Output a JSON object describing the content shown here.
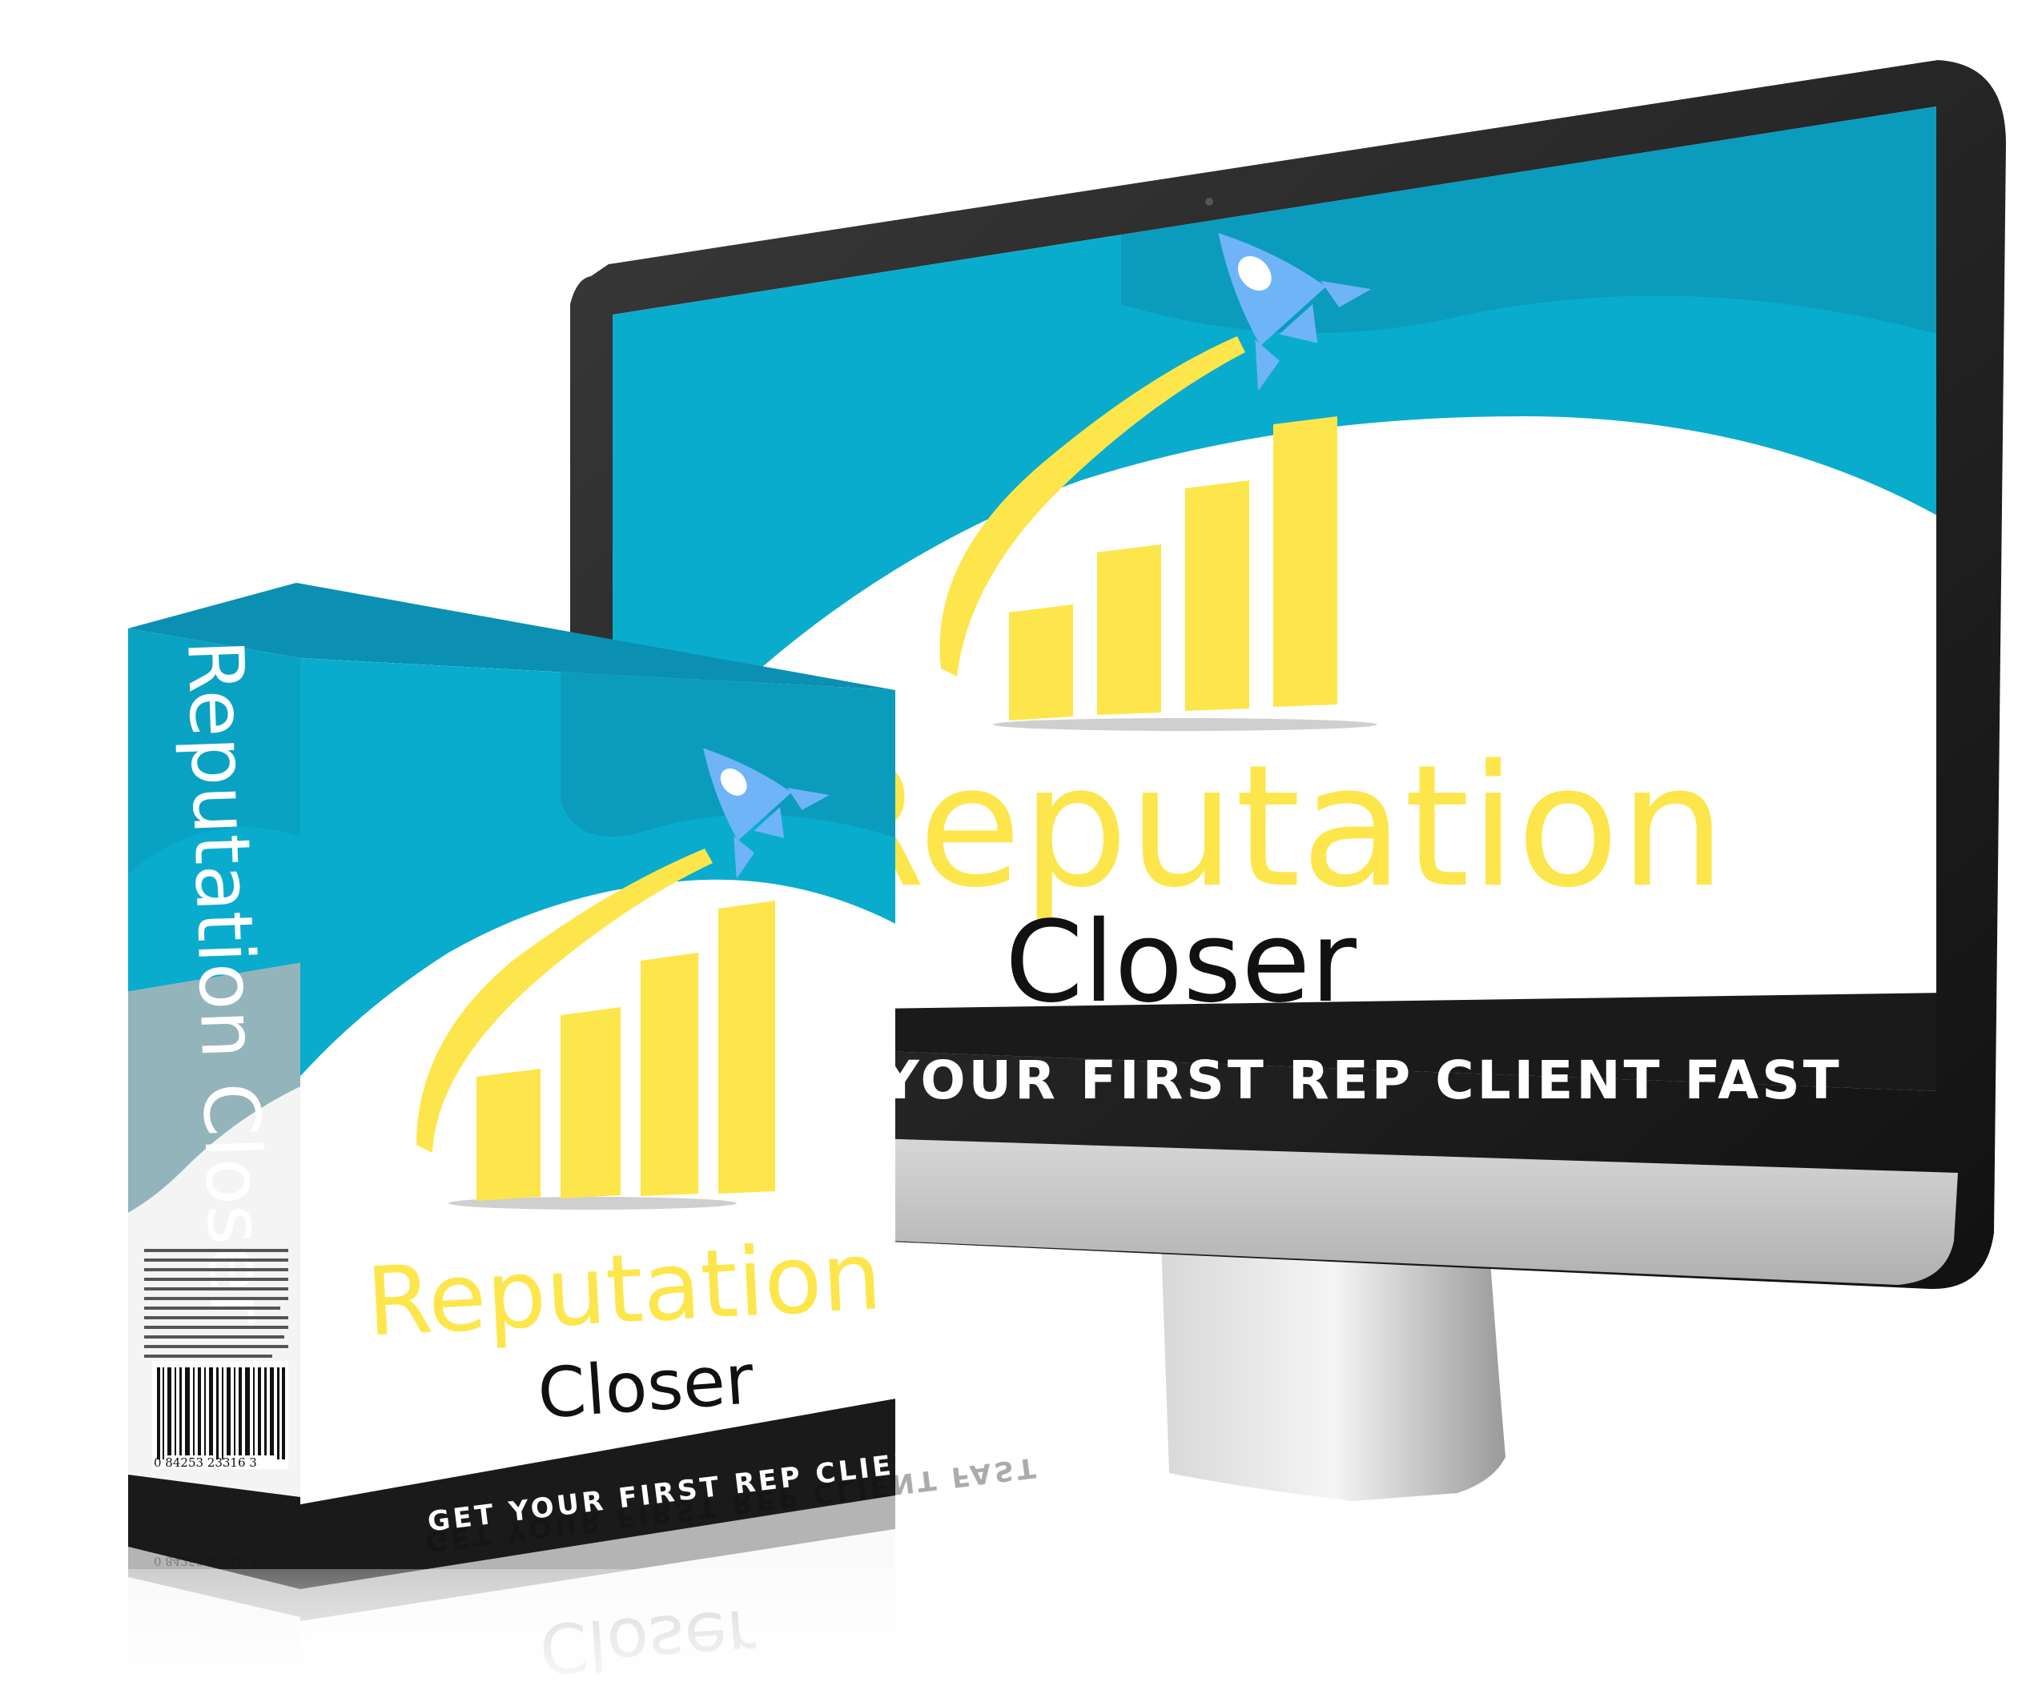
{
  "product": {
    "title_line1": "Reputation",
    "title_line2": "Closer",
    "tagline": "GET YOUR FIRST REP CLIENT FAST",
    "monitor_tagline": "YOUR FIRST REP CLIENT FAST",
    "spine_title": "Reputation Closer",
    "barcode_number": "0  84253  23316  3"
  },
  "colors": {
    "cyan": "#0aaccd",
    "cyan_dark": "#0b8fb3",
    "yellow": "#fde64b",
    "rocket_blue": "#6fb4f7",
    "black_band": "#1a1a1a",
    "white": "#ffffff",
    "gray_side": "#b7b7b7"
  },
  "icons": {
    "rocket": "rocket-icon",
    "bars": "bar-chart-icon",
    "barcode": "barcode-icon"
  }
}
